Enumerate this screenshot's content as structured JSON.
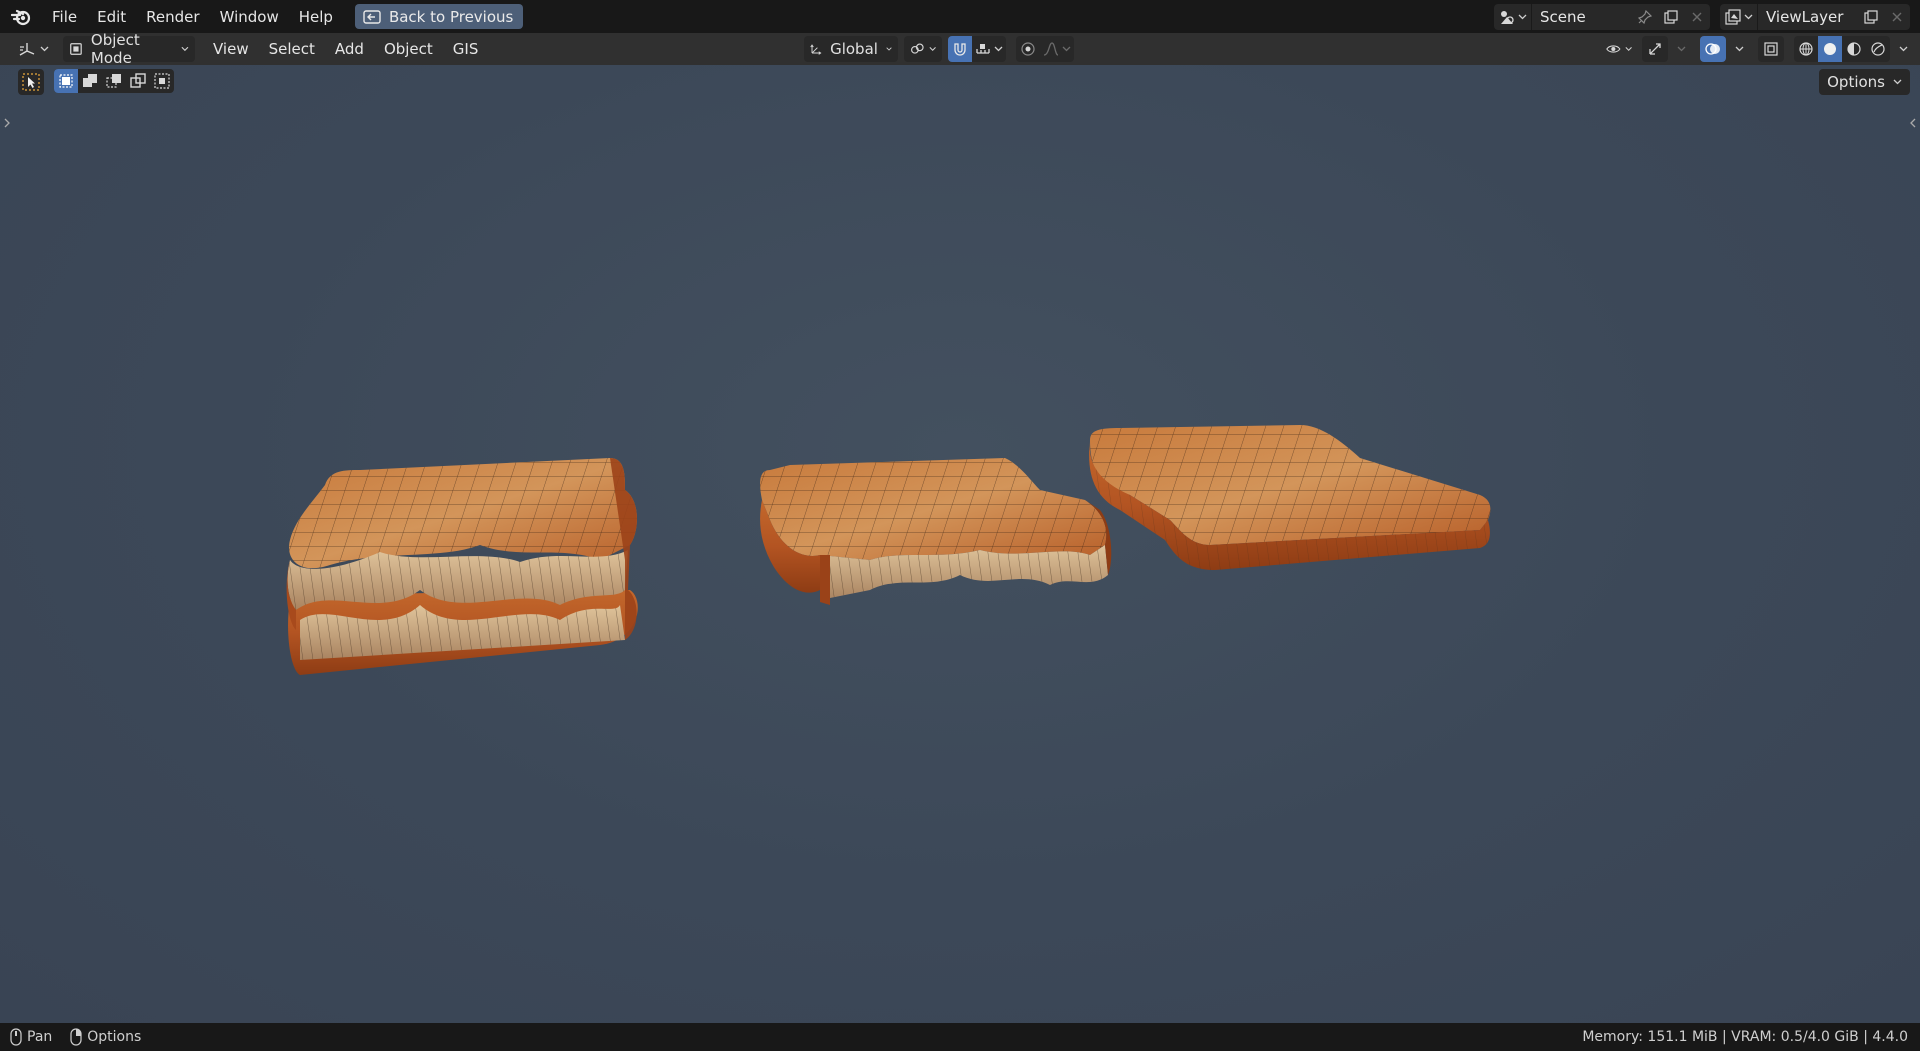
{
  "app": {
    "menu": [
      "File",
      "Edit",
      "Render",
      "Window",
      "Help"
    ],
    "back_button": "Back to Previous",
    "scene_name": "Scene",
    "view_layer_name": "ViewLayer"
  },
  "header": {
    "mode": "Object Mode",
    "menus": [
      "View",
      "Select",
      "Add",
      "Object",
      "GIS"
    ],
    "orientation": "Global",
    "options_label": "Options"
  },
  "status": {
    "left": [
      {
        "icon": "mouse-middle-icon",
        "label": "Pan"
      },
      {
        "icon": "mouse-right-icon",
        "label": "Options"
      }
    ],
    "right": "Memory: 151.1 MiB | VRAM: 0.5/4.0 GiB | 4.4.0"
  },
  "colors": {
    "accent": "#4772b3",
    "viewport_bg": "#3d4a5a",
    "toast_crust": "#b8541e",
    "toast_crumb": "#c9a77c"
  },
  "viewport": {
    "objects": [
      "toast-slice-1",
      "toast-slice-2",
      "toast-slice-3"
    ]
  }
}
